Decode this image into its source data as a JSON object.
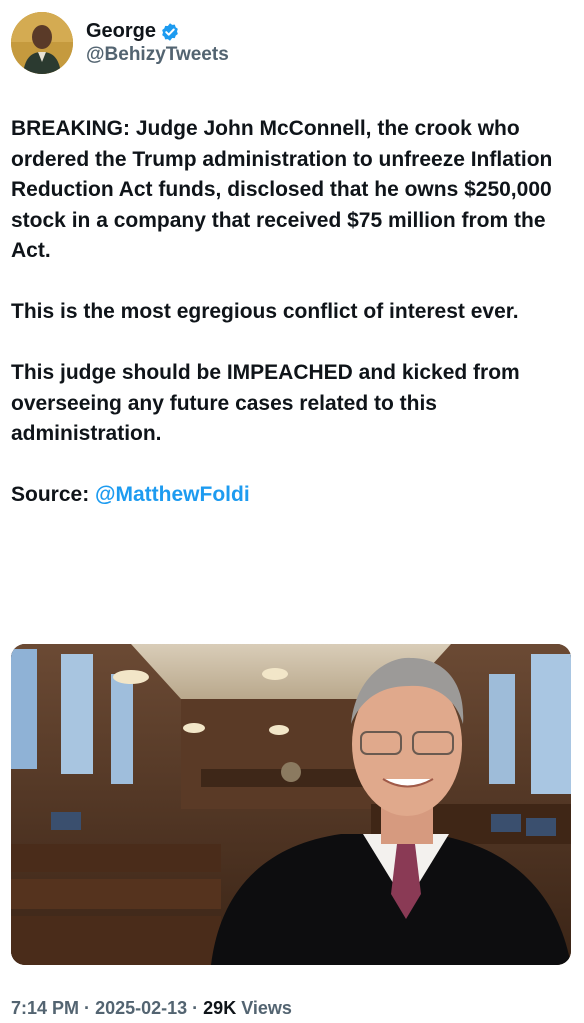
{
  "author": {
    "display_name": "George",
    "handle": "@BehizyTweets",
    "verified": true,
    "avatar_icon": "profile-photo"
  },
  "tweet": {
    "paragraph_1": "BREAKING: Judge John McConnell, the crook who ordered the Trump administration to unfreeze Inflation Reduction Act funds, disclosed that he owns $250,000 stock in a company that received $75 million from the Act.",
    "paragraph_2": "This is the most egregious conflict of interest ever.",
    "paragraph_3": "This judge should be IMPEACHED and kicked from overseeing any future cases related to this administration.",
    "source_label": "Source: ",
    "source_mention": "@MatthewFoldi"
  },
  "media": {
    "type": "photo",
    "subject": "judge-in-courtroom-photo"
  },
  "meta": {
    "time": "7:14 PM",
    "separator": "·",
    "date": "2025-02-13",
    "views_count": "29K",
    "views_label": "Views"
  },
  "colors": {
    "text": "#0f1419",
    "secondary": "#536471",
    "link": "#1d9bf0",
    "verified_badge": "#1d9bf0"
  }
}
